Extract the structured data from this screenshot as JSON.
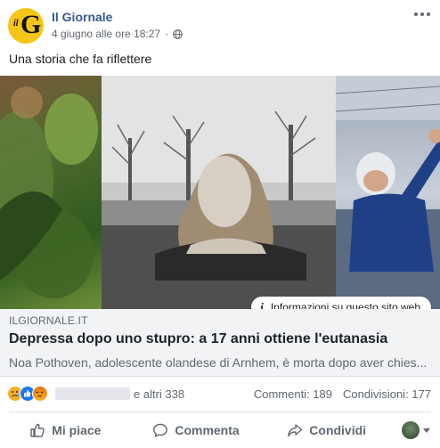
{
  "post": {
    "page_name": "Il Giornale",
    "timestamp": "4 giugno alle ore 18:27",
    "text": "Una storia che fa riflettere"
  },
  "icons": {
    "avatar": "il-giornale-logo",
    "privacy": "globe-icon",
    "menu": "more-icon",
    "info": "info-icon"
  },
  "media": {
    "info_label": "Informazioni su questo sito web"
  },
  "link": {
    "domain": "ILGIORNALE.IT",
    "title": "Depressa dopo uno stupro: a 17 anni ottiene l'eutanasia",
    "description": "Noa Pothoven, adolescente olandese di Arnhem, è morta dopo aver chies..."
  },
  "reactions": {
    "types": [
      "sad",
      "like",
      "angry"
    ],
    "others": "e altri 338",
    "comments": "Commenti: 189",
    "shares": "Condivisioni: 177"
  },
  "actions": {
    "like": "Mi piace",
    "comment": "Commenta",
    "share": "Condividi"
  },
  "colors": {
    "brand": "#385898",
    "like_blue": "#1877f2",
    "secondary_text": "#606770",
    "link_box_bg": "#f2f3f5",
    "logo_yellow": "#f5c518"
  }
}
